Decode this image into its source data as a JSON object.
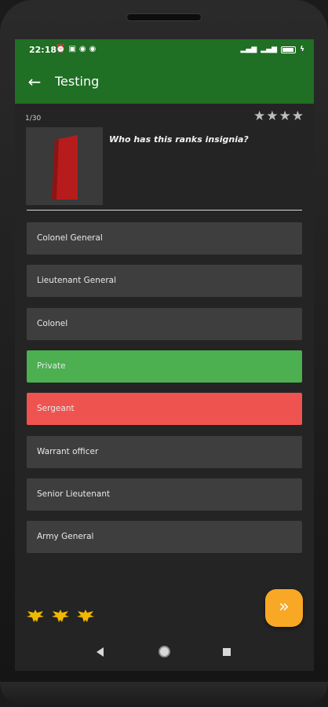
{
  "status_bar": {
    "time": "22:18",
    "left_icons": [
      "alarm-icon",
      "message-icon",
      "sync-icon",
      "vpn-icon"
    ],
    "right_icons": [
      "signal-icon",
      "signal-icon-2",
      "battery-icon"
    ],
    "battery_level": "85"
  },
  "app_bar": {
    "title": "Testing",
    "back_icon": "arrow-left-icon",
    "background_color": "#1f6f24"
  },
  "quiz": {
    "counter": "1/30",
    "stars_count": 4,
    "question": "Who has this ranks insignia?",
    "insignia_color": "#b71c1c"
  },
  "answers": [
    {
      "label": "Colonel General",
      "state": "default"
    },
    {
      "label": "Lieutenant General",
      "state": "default"
    },
    {
      "label": "Colonel",
      "state": "default"
    },
    {
      "label": "Private",
      "state": "correct"
    },
    {
      "label": "Sergeant",
      "state": "wrong"
    },
    {
      "label": "Warrant officer",
      "state": "default"
    },
    {
      "label": "Senior Lieutenant",
      "state": "default"
    },
    {
      "label": "Army General",
      "state": "default"
    }
  ],
  "colors": {
    "correct": "#4caf50",
    "wrong": "#ef5350",
    "fab": "#f9a825",
    "medal": "#f0b800"
  },
  "lives_icons": [
    "eagle-emblem-icon",
    "eagle-emblem-icon",
    "eagle-emblem-icon"
  ],
  "fab": {
    "icon": "double-chevron-right-icon",
    "glyph": "»"
  },
  "navigation": {
    "back": "nav-back-icon",
    "home": "nav-home-icon",
    "recents": "nav-recents-icon"
  }
}
